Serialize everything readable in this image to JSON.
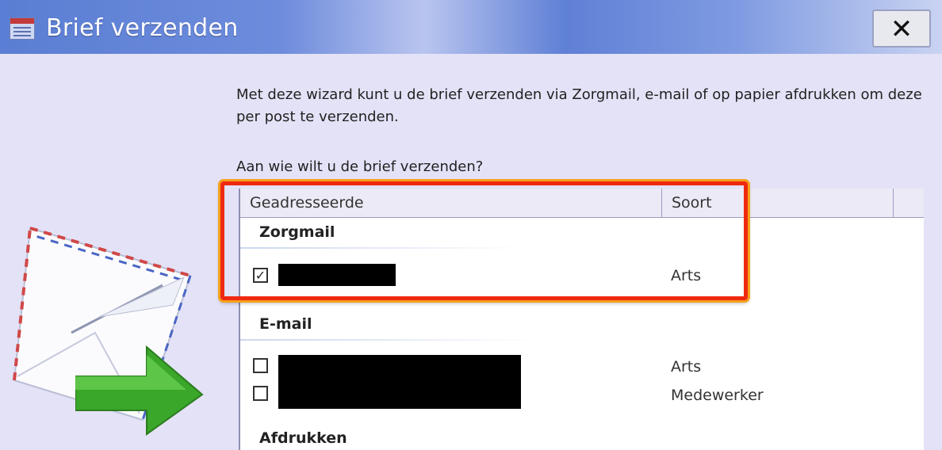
{
  "window": {
    "title": "Brief verzenden",
    "close_label": "✕"
  },
  "intro_text": "Met deze wizard kunt u de brief verzenden via Zorgmail, e-mail of op papier afdrukken om deze per post te verzenden.",
  "question": "Aan wie wilt u de brief verzenden?",
  "columns": [
    "Geadresseerde",
    "Soort"
  ],
  "groups": [
    {
      "name": "Zorgmail",
      "rows": [
        {
          "checked": true,
          "recipient": "[redacted]",
          "type": "Arts"
        }
      ]
    },
    {
      "name": "E-mail",
      "rows": [
        {
          "checked": false,
          "recipient": "[redacted]",
          "type": "Arts"
        },
        {
          "checked": false,
          "recipient": "[redacted]",
          "type": "Medewerker"
        }
      ]
    },
    {
      "name": "Afdrukken",
      "rows": []
    }
  ],
  "colors": {
    "highlight": "#ee2a10",
    "arrow": "#3aa62a"
  },
  "icons": [
    "app-icon",
    "close-icon",
    "envelope-icon",
    "arrow-right-icon",
    "checkbox-checked-icon",
    "checkbox-empty-icon"
  ]
}
